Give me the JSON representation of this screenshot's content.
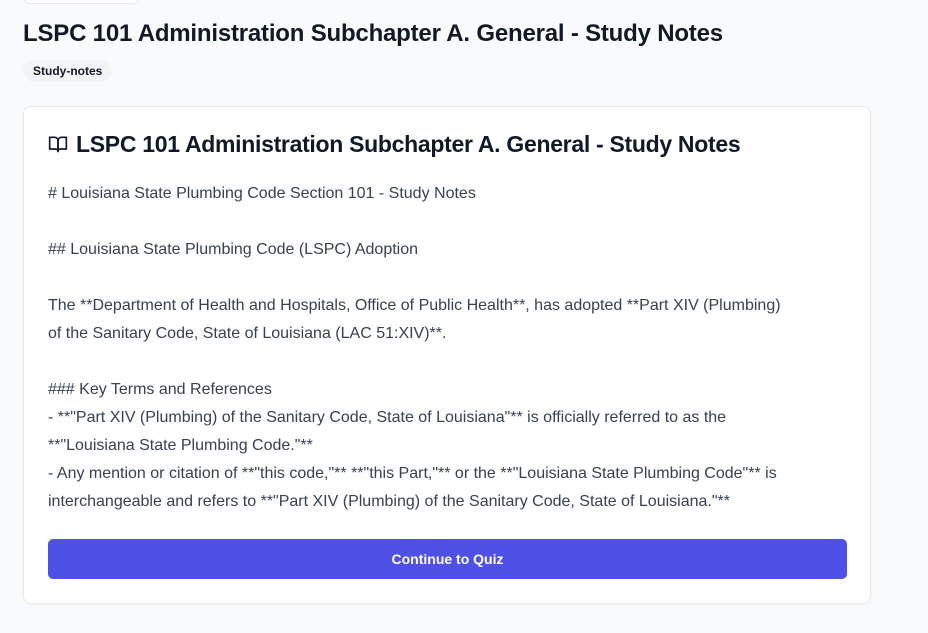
{
  "page": {
    "title": "LSPC 101 Administration Subchapter A. General - Study Notes",
    "tag": "Study-notes"
  },
  "card": {
    "icon": "book-open-icon",
    "title": "LSPC 101 Administration Subchapter A. General - Study Notes",
    "lines": [
      "# Louisiana State Plumbing Code Section 101 - Study Notes",
      "",
      "## Louisiana State Plumbing Code (LSPC) Adoption",
      "",
      "The **Department of Health and Hospitals, Office of Public Health**, has adopted **Part XIV (Plumbing)",
      "of the Sanitary Code, State of Louisiana (LAC 51:XIV)**.",
      "",
      "### Key Terms and References",
      "- **\"Part XIV (Plumbing) of the Sanitary Code, State of Louisiana\"** is officially referred to as the",
      "**\"Louisiana State Plumbing Code.\"**",
      "- Any mention or citation of **\"this code,\"** **\"this Part,\"** or the **\"Louisiana State Plumbing Code\"** is",
      "interchangeable and refers to **\"Part XIV (Plumbing) of the Sanitary Code, State of Louisiana.\"**"
    ],
    "button_label": "Continue to Quiz"
  },
  "colors": {
    "accent": "#4f51e6",
    "background": "#f9fafb",
    "card": "#ffffff",
    "text": "#374151"
  }
}
